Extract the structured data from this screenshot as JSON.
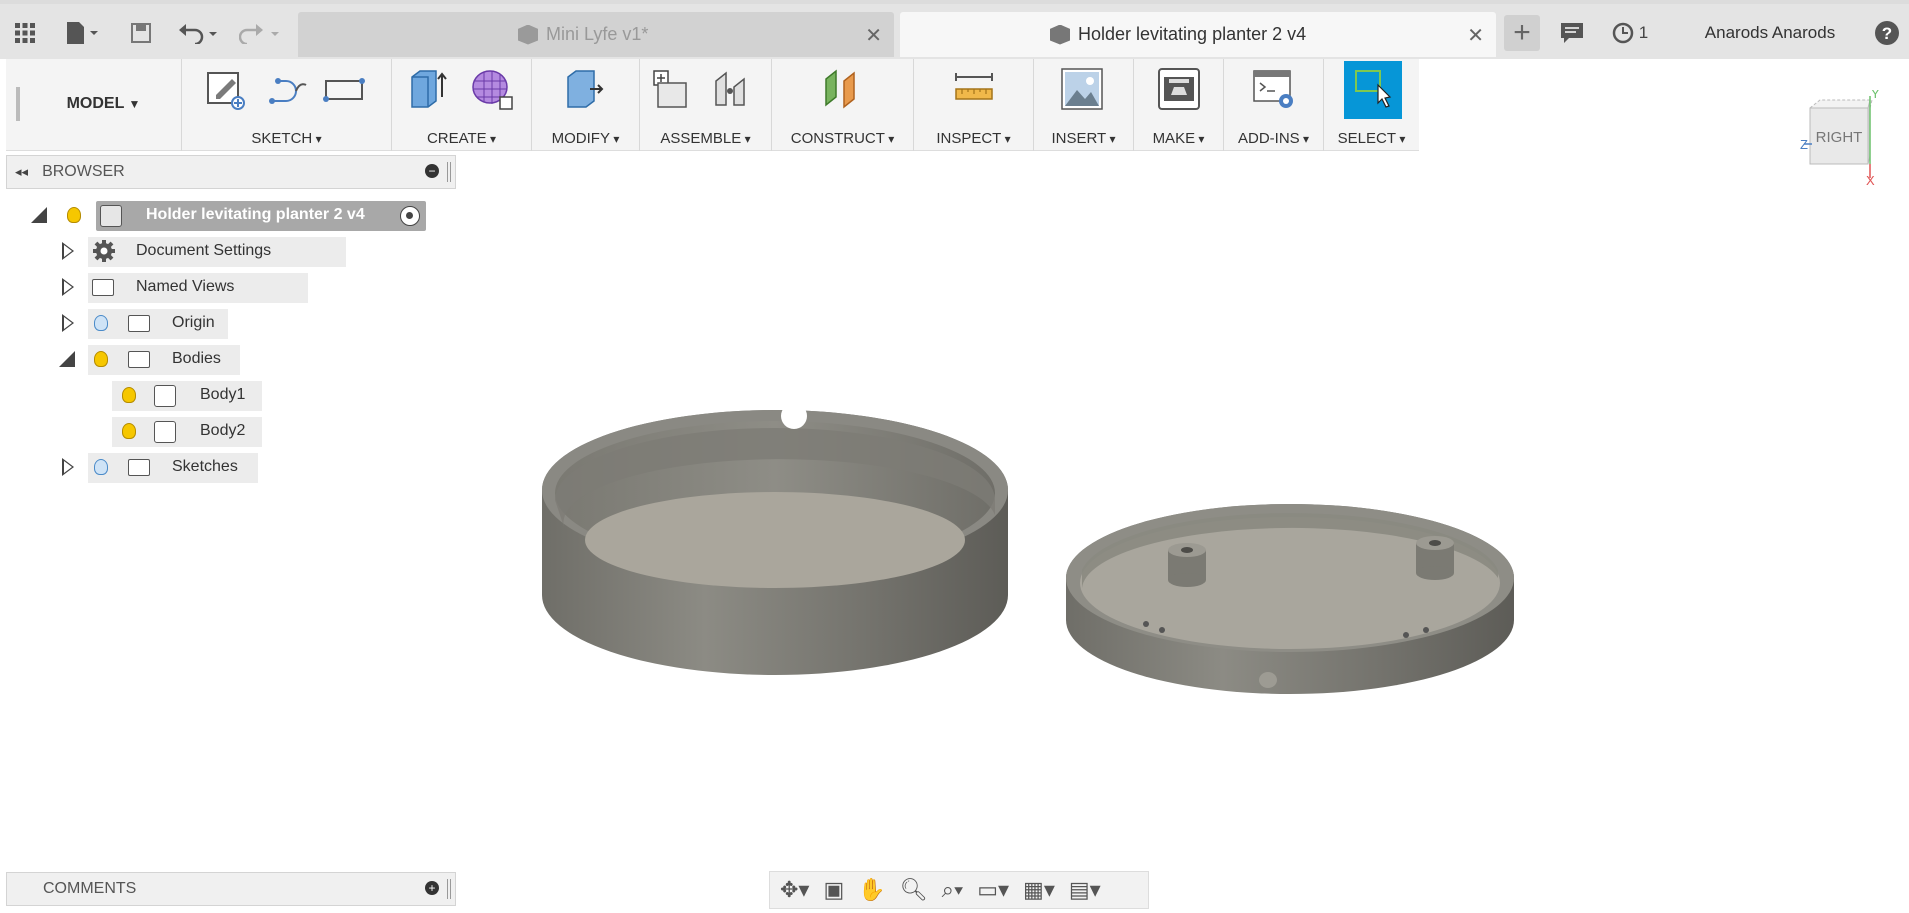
{
  "window": {
    "user": "Anarods Anarods",
    "job_count": "1"
  },
  "tabs": [
    {
      "label": "Mini Lyfe v1*",
      "active": false
    },
    {
      "label": "Holder levitating planter 2 v4",
      "active": true
    }
  ],
  "workspace": {
    "label": "MODEL"
  },
  "toolbar_groups": [
    {
      "label": "SKETCH"
    },
    {
      "label": "CREATE"
    },
    {
      "label": "MODIFY"
    },
    {
      "label": "ASSEMBLE"
    },
    {
      "label": "CONSTRUCT"
    },
    {
      "label": "INSPECT"
    },
    {
      "label": "INSERT"
    },
    {
      "label": "MAKE"
    },
    {
      "label": "ADD-INS"
    },
    {
      "label": "SELECT"
    }
  ],
  "browser": {
    "title": "BROWSER",
    "root": "Holder levitating planter 2 v4",
    "items": [
      {
        "label": "Document Settings"
      },
      {
        "label": "Named Views"
      },
      {
        "label": "Origin"
      },
      {
        "label": "Bodies"
      },
      {
        "label": "Body1"
      },
      {
        "label": "Body2"
      },
      {
        "label": "Sketches"
      }
    ]
  },
  "comments": {
    "title": "COMMENTS"
  },
  "viewcube": {
    "face": "RIGHT",
    "axes": [
      "Y",
      "Z",
      "X"
    ]
  },
  "colors": {
    "accent": "#0696d7",
    "bulb_on": "#f6c700",
    "bulb_off": "#cfe3f6",
    "model": "#8a8880"
  }
}
